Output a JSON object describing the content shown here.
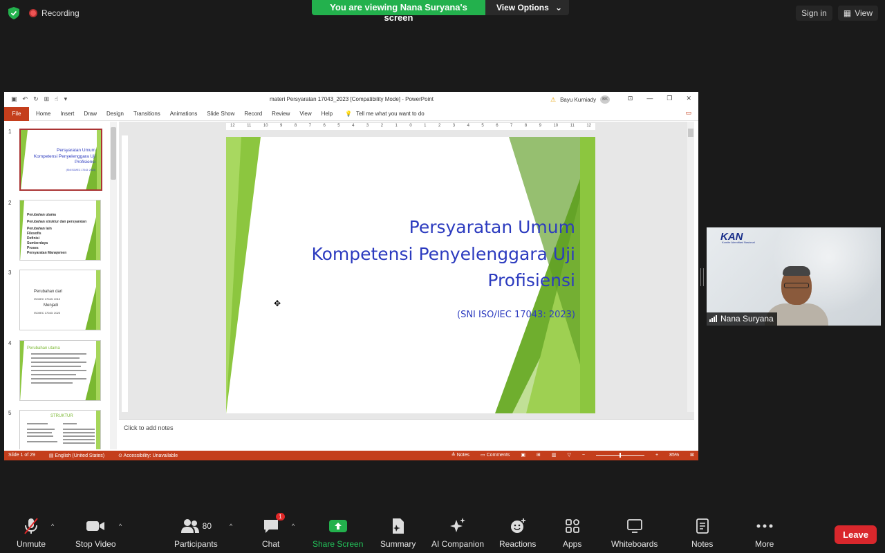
{
  "zoom": {
    "recording_label": "Recording",
    "viewing_banner": "You are viewing Nana Suryana's screen",
    "view_options_label": "View Options",
    "sign_in_label": "Sign in",
    "view_label": "View",
    "participant_name": "Nana Suryana",
    "participants_count": "80",
    "chat_badge": "1",
    "leave_label": "Leave",
    "toolbar": {
      "unmute": "Unmute",
      "stop_video": "Stop Video",
      "participants": "Participants",
      "chat": "Chat",
      "share_screen": "Share Screen",
      "summary": "Summary",
      "ai_companion": "AI Companion",
      "reactions": "Reactions",
      "apps": "Apps",
      "whiteboards": "Whiteboards",
      "notes": "Notes",
      "more": "More"
    },
    "video_logo": "KAN",
    "video_logo_sub": "Komite Akreditasi Nasional"
  },
  "powerpoint": {
    "doc_title": "materi Persyaratan  17043_2023 [Compatibility Mode]  -  PowerPoint",
    "user_name": "Bayu Kurniady",
    "user_initials": "BK",
    "tabs": [
      "File",
      "Home",
      "Insert",
      "Draw",
      "Design",
      "Transitions",
      "Animations",
      "Slide Show",
      "Record",
      "Review",
      "View",
      "Help"
    ],
    "tell_me": "Tell me what you want to do",
    "ruler_ticks": [
      "12",
      "11",
      "10",
      "9",
      "8",
      "7",
      "6",
      "5",
      "4",
      "3",
      "2",
      "1",
      "0",
      "1",
      "2",
      "3",
      "4",
      "5",
      "6",
      "7",
      "8",
      "9",
      "10",
      "11",
      "12"
    ],
    "slide": {
      "title_line1": "Persyaratan Umum",
      "title_line2": "Kompetensi Penyelenggara Uji",
      "title_line3": "Profisiensi",
      "subtitle": "(SNI ISO/IEC 17043: 2023)"
    },
    "thumbnails": [
      {
        "num": "1",
        "title1": "Persyaratan Umum",
        "title2": "Kompetensi Penyelenggara Uji",
        "title3": "Profisiensi",
        "sub": "(SNI ISO/IEC 17043: 2023)"
      },
      {
        "num": "2",
        "lines": [
          "Perubahan utama",
          "Perubahan struktur dan persyaratan",
          "Perubahan lain",
          "Filosofis",
          "Definisi",
          "Sumberdaya",
          "Proses",
          "Persyaratan Manajemen"
        ]
      },
      {
        "num": "3",
        "lines": [
          "Perubahan dari",
          "ISO/IEC 17043: 2010",
          "Menjadi",
          "ISO/IEC 17043: 2023"
        ]
      },
      {
        "num": "4",
        "heading": "Perubahan utama"
      },
      {
        "num": "5",
        "heading": "STRUKTUR"
      }
    ],
    "notes_placeholder": "Click to add notes",
    "status": {
      "slide": "Slide 1 of 29",
      "language": "English (United States)",
      "accessibility": "Accessibility: Unavailable",
      "notes": "Notes",
      "comments": "Comments",
      "zoom": "85%"
    }
  }
}
